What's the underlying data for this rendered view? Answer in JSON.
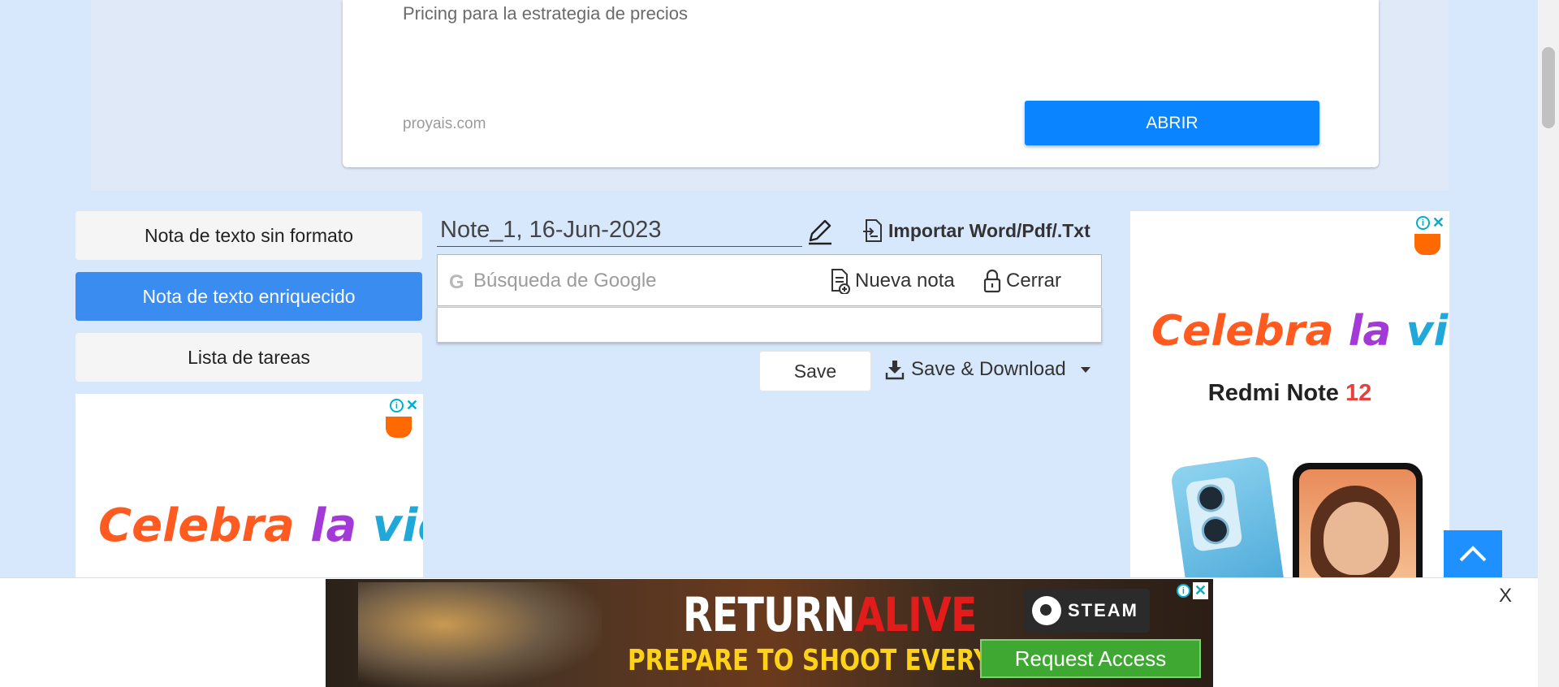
{
  "top_ad": {
    "description": "Pricing para la estrategia de precios",
    "domain": "proyais.com",
    "button_label": "ABRIR"
  },
  "menu": {
    "items": [
      {
        "label": "Nota de texto sin formato",
        "active": false
      },
      {
        "label": "Nota de texto enriquecido",
        "active": true
      },
      {
        "label": "Lista de tareas",
        "active": false
      }
    ]
  },
  "editor": {
    "note_title": "Note_1, 16-Jun-2023",
    "import_label": "Importar Word/Pdf/.Txt",
    "search_placeholder": "Búsqueda de Google",
    "search_icon_letter": "G",
    "new_note_label": "Nueva nota",
    "close_label": "Cerrar",
    "save_label": "Save",
    "save_download_label": "Save & Download"
  },
  "left_ad": {
    "headline_parts": [
      "Celebra ",
      "la ",
      "vida"
    ]
  },
  "right_ad": {
    "headline_parts": [
      "Celebra ",
      "la ",
      "vida"
    ],
    "product": "Redmi Note ",
    "product_number": "12"
  },
  "bottom_ad": {
    "title_part1": "RETURN",
    "title_part2": "ALIVE",
    "tagline": "PREPARE TO SHOOT EVERYTHING",
    "brand": "STEAM",
    "cta": "Request Access",
    "close_label": "X"
  },
  "colors": {
    "page_bg": "#d7e7fc",
    "accent_blue": "#0a85ff",
    "active_menu": "#3b8cf0",
    "scroll_top_bg": "#1e90ff"
  }
}
